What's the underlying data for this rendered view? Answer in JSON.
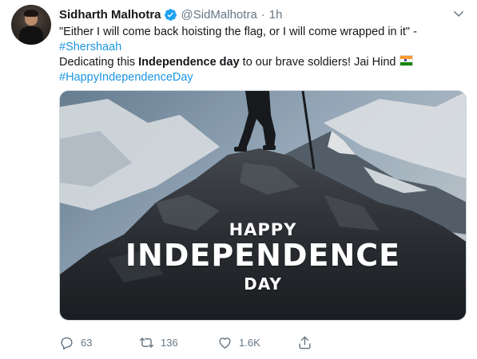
{
  "tweet": {
    "author_name": "Sidharth Malhotra",
    "handle": "@SidMalhotra",
    "separator": "·",
    "time": "1h",
    "text_line1": "\"Either I will come back hoisting the flag, or I will come wrapped in it\" -",
    "hashtag1": "#Shershaah",
    "text_line3_part1": "Dedicating this ",
    "text_line3_bold": "Independence day",
    "text_line3_part2": " to our brave soldiers! Jai Hind",
    "hashtag2": "#HappyIndependenceDay",
    "flag_emoji": "indian-flag-icon"
  },
  "media": {
    "line1": "HAPPY",
    "line2": "INDEPENDENCE",
    "line3": "DAY"
  },
  "actions": {
    "reply_count": "63",
    "retweet_count": "136",
    "like_count": "1.6K"
  },
  "colors": {
    "link": "#1b95e0",
    "muted": "#657786",
    "verified": "#1da1f2"
  }
}
